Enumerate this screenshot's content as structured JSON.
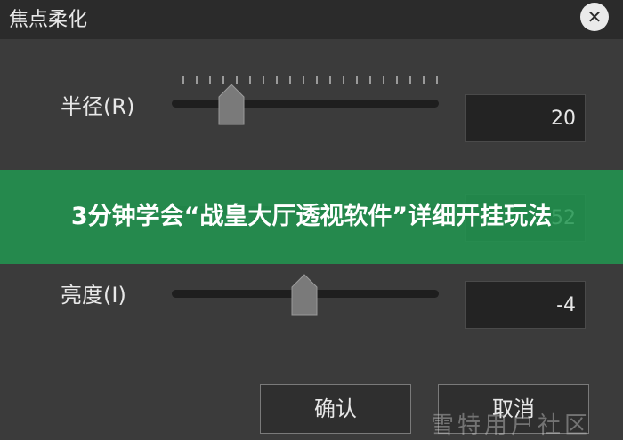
{
  "dialog": {
    "title": "焦点柔化",
    "close_icon": "close-icon"
  },
  "sliders": [
    {
      "label": "半径(R)",
      "value": "20",
      "thumb_fraction": 0.22
    },
    {
      "label": "",
      "value": "52",
      "thumb_fraction": 0.5
    },
    {
      "label": "亮度(I)",
      "value": "-4",
      "thumb_fraction": 0.5
    }
  ],
  "banner": {
    "text": "3分钟学会“战皇大厅透视软件”详细开挂玩法",
    "color": "#229650"
  },
  "buttons": {
    "ok_label": "确认",
    "cancel_label": "取消"
  },
  "watermark": "雪特用户社区"
}
